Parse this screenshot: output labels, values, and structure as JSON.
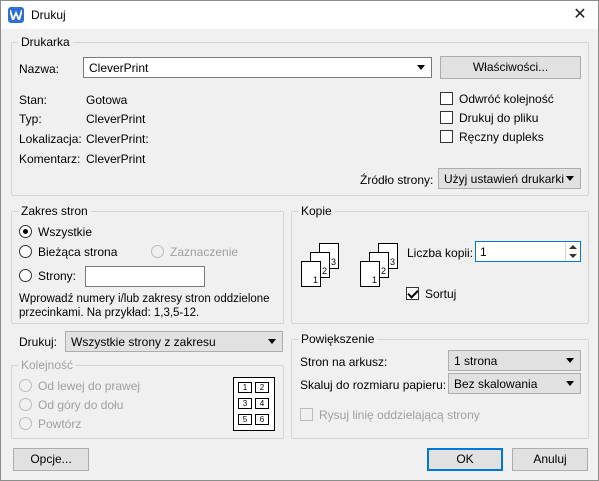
{
  "title": "Drukuj",
  "printer": {
    "group_label": "Drukarka",
    "name_label": "Nazwa:",
    "name_value": "CleverPrint",
    "properties_button": "Właściwości...",
    "status_label": "Stan:",
    "status_value": "Gotowa",
    "type_label": "Typ:",
    "type_value": "CleverPrint",
    "location_label": "Lokalizacja:",
    "location_value": "CleverPrint:",
    "comment_label": "Komentarz:",
    "comment_value": "CleverPrint",
    "reverse_order": "Odwróć kolejność",
    "print_to_file": "Drukuj do pliku",
    "manual_duplex": "Ręczny dupleks",
    "source_label": "Źródło strony:",
    "source_value": "Użyj ustawień drukarki"
  },
  "page_range": {
    "group_label": "Zakres stron",
    "all": "Wszystkie",
    "current": "Bieżąca strona",
    "selection": "Zaznaczenie",
    "pages": "Strony:",
    "pages_value": "",
    "hint": "Wprowadź numery i/lub zakresy stron oddzielone",
    "hint2": "przecinkami. Na przykład: 1,3,5-12."
  },
  "copies": {
    "group_label": "Kopie",
    "count_label": "Liczba kopii:",
    "count_value": "1",
    "collate": "Sortuj",
    "collate_checked": true
  },
  "print_what": {
    "label": "Drukuj:",
    "value": "Wszystkie strony z zakresu"
  },
  "order": {
    "group_label": "Kolejność",
    "left_to_right": "Od lewej do prawej",
    "top_to_bottom": "Od góry do dołu",
    "repeat": "Powtórz",
    "grid": [
      "1",
      "2",
      "3",
      "4",
      "5",
      "6"
    ]
  },
  "zoom": {
    "group_label": "Powiększenie",
    "pages_per_sheet_label": "Stron na arkusz:",
    "pages_per_sheet_value": "1 strona",
    "scale_label": "Skaluj do rozmiaru papieru:",
    "scale_value": "Bez skalowania",
    "separator_line": "Rysuj linię oddzielającą strony"
  },
  "footer": {
    "options": "Opcje...",
    "ok": "OK",
    "cancel": "Anuluj"
  }
}
